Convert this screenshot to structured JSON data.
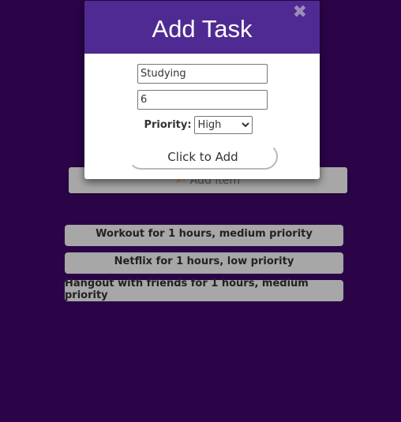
{
  "page": {
    "add_item_label": "Add item",
    "tasks": [
      {
        "text": "Workout for 1 hours, medium priority"
      },
      {
        "text": "Netflix for 1 hours, low priority"
      },
      {
        "text": "Hangout with friends for 1 hours, medium priority"
      }
    ]
  },
  "modal": {
    "title": "Add Task",
    "close_symbol": "✖",
    "task_name_value": "Studying",
    "hours_value": "6",
    "priority_label": "Priority:",
    "priority_selected": "High",
    "submit_label": "Click to Add"
  },
  "icons": {
    "add_item": "pencil-icon",
    "close": "close-icon"
  },
  "colors": {
    "background": "#2b0448",
    "modal_header": "#4f2a92",
    "item_bg": "#a7a7a7"
  }
}
